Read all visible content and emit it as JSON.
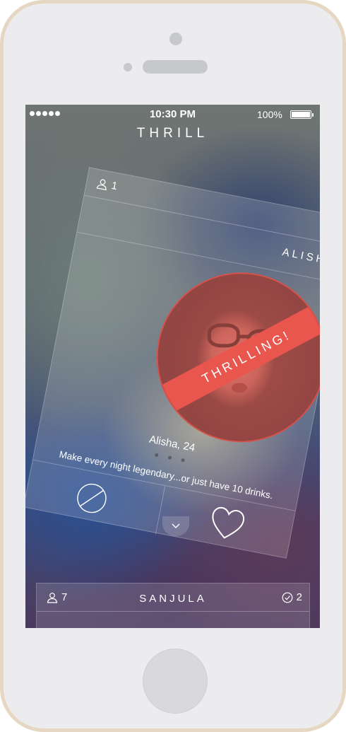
{
  "status_bar": {
    "time": "10:30 PM",
    "battery": "100%"
  },
  "app": {
    "title": "THRILL"
  },
  "card": {
    "member_count": "1",
    "group_name": "ALISHA",
    "badge": "THRILLING!",
    "person": "Alisha, 24",
    "tagline": "Make every night legendary...or just have 10 drinks."
  },
  "next_card": {
    "member_count": "7",
    "group_name": "SANJULA",
    "check_count": "2"
  },
  "icons": {
    "members": "person-icon",
    "pass": "pass-icon",
    "like": "heart-icon",
    "expand": "chevron-down-icon",
    "check": "check-circle-icon"
  },
  "colors": {
    "accent": "#e8564e",
    "text": "#ffffff"
  }
}
